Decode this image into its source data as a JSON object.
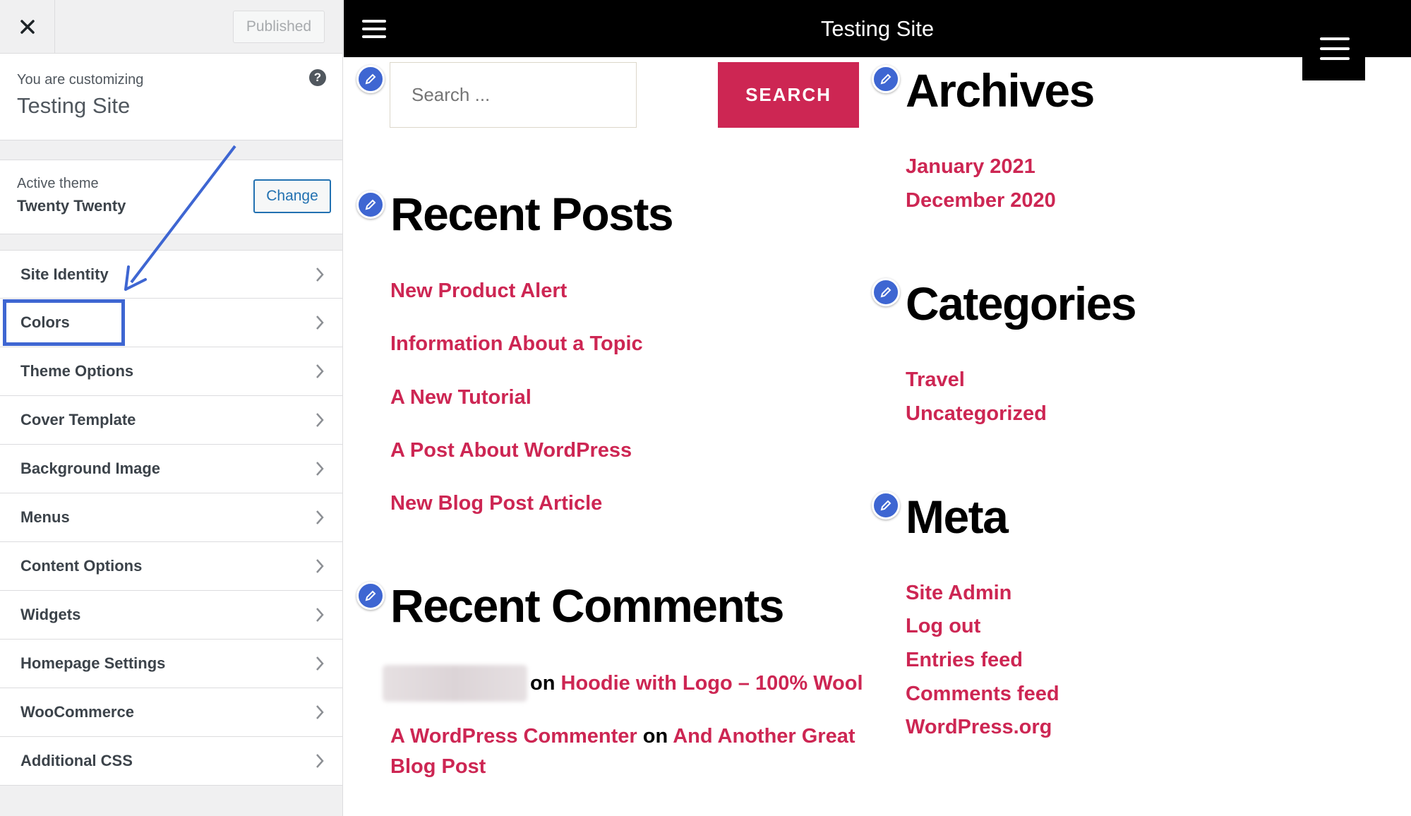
{
  "sidebar": {
    "publish_label": "Published",
    "customizing_label": "You are customizing",
    "site_name": "Testing Site",
    "active_theme_label": "Active theme",
    "theme_name": "Twenty Twenty",
    "change_label": "Change",
    "items": [
      {
        "label": "Site Identity"
      },
      {
        "label": "Colors"
      },
      {
        "label": "Theme Options"
      },
      {
        "label": "Cover Template"
      },
      {
        "label": "Background Image"
      },
      {
        "label": "Menus"
      },
      {
        "label": "Content Options"
      },
      {
        "label": "Widgets"
      },
      {
        "label": "Homepage Settings"
      },
      {
        "label": "WooCommerce"
      },
      {
        "label": "Additional CSS"
      }
    ]
  },
  "preview": {
    "site_title": "Testing Site",
    "search": {
      "placeholder": "Search ...",
      "button": "SEARCH"
    },
    "recent_posts": {
      "title": "Recent Posts",
      "items": [
        "New Product Alert",
        "Information About a Topic",
        "A New Tutorial",
        "A Post About WordPress",
        "New Blog Post Article"
      ]
    },
    "recent_comments": {
      "title": "Recent Comments",
      "items": [
        {
          "author": "",
          "on": "on",
          "post": "Hoodie with Logo – 100% Wool"
        },
        {
          "author": "A WordPress Commenter",
          "on": "on",
          "post_line1": "And Another Great",
          "post_line2": "Blog Post"
        }
      ]
    },
    "archives": {
      "title": "Archives",
      "items": [
        "January 2021",
        "December 2020"
      ]
    },
    "categories": {
      "title": "Categories",
      "items": [
        "Travel",
        "Uncategorized"
      ]
    },
    "meta": {
      "title": "Meta",
      "items": [
        "Site Admin",
        "Log out",
        "Entries feed",
        "Comments feed",
        "WordPress.org"
      ]
    }
  },
  "colors": {
    "accent": "#cd2653",
    "edit_blue": "#3e66d2",
    "header": "#000000"
  }
}
